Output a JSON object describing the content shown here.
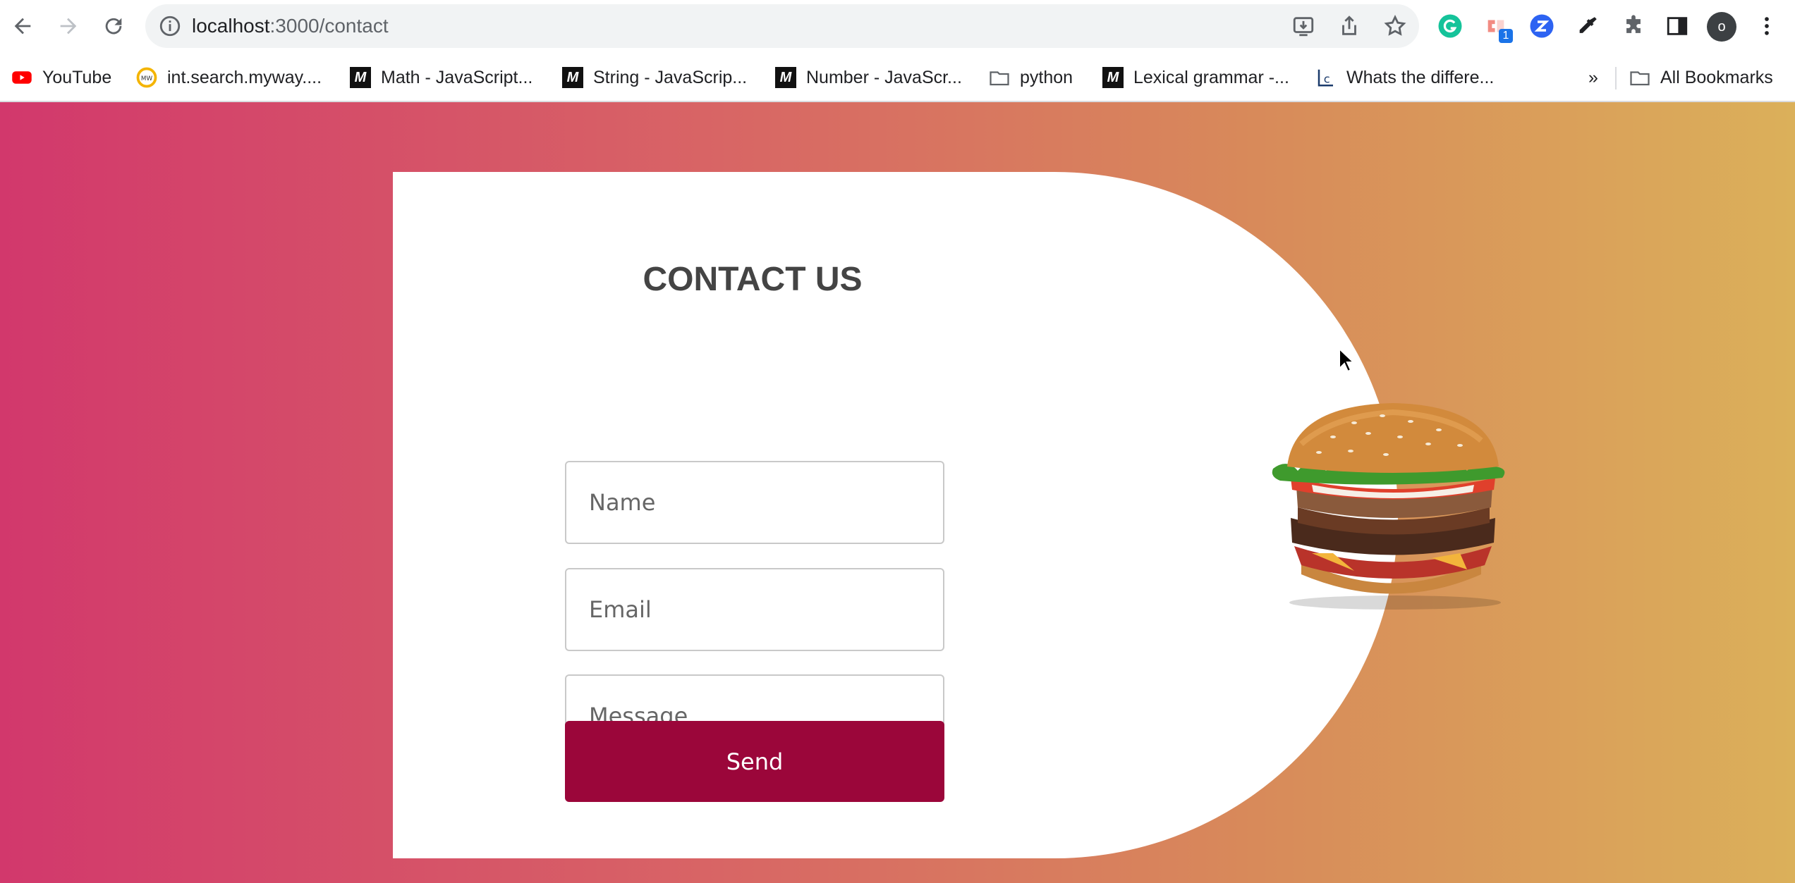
{
  "browser": {
    "url_host": "localhost",
    "url_path": ":3000/contact",
    "extension_badge": "1",
    "profile_initial": "o",
    "bookmarks": [
      {
        "label": "YouTube",
        "icon": "youtube-icon"
      },
      {
        "label": "int.search.myway....",
        "icon": "myway-icon"
      },
      {
        "label": "Math - JavaScript...",
        "icon": "mdn-icon"
      },
      {
        "label": "String - JavaScrip...",
        "icon": "mdn-icon"
      },
      {
        "label": "Number - JavaScr...",
        "icon": "mdn-icon"
      },
      {
        "label": "python",
        "icon": "folder-icon"
      },
      {
        "label": "Lexical grammar -...",
        "icon": "mdn-icon"
      },
      {
        "label": "Whats the differe...",
        "icon": "c-icon"
      }
    ],
    "overflow_label": "»",
    "all_bookmarks": "All Bookmarks"
  },
  "contact": {
    "title": "CONTACT US",
    "name_placeholder": "Name",
    "email_placeholder": "Email",
    "message_placeholder": "Message...",
    "send_label": "Send"
  },
  "colors": {
    "gradient_start": "#d2386c",
    "gradient_end": "#dbb05a",
    "send_button": "#9b063a",
    "card": "#ffffff"
  }
}
